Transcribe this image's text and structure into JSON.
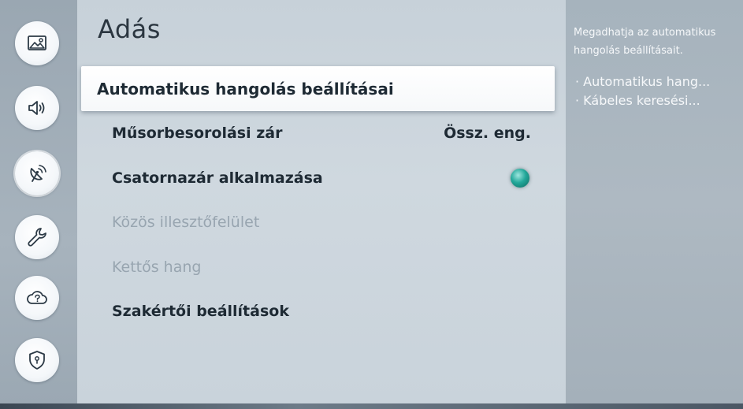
{
  "sidebar": {
    "items": [
      {
        "icon": "picture-icon",
        "active": false
      },
      {
        "icon": "sound-icon",
        "active": false
      },
      {
        "icon": "broadcast-icon",
        "active": true
      },
      {
        "icon": "wrench-icon",
        "active": false
      },
      {
        "icon": "support-cloud-icon",
        "active": false
      },
      {
        "icon": "shield-icon",
        "active": false
      }
    ]
  },
  "main": {
    "title": "Adás",
    "items": [
      {
        "label": "Automatikus hangolás beállításai",
        "value": "",
        "state": "focused"
      },
      {
        "label": "Műsorbesorolási zár",
        "value": "Össz. eng.",
        "state": "enabled"
      },
      {
        "label": "Csatornazár alkalmazása",
        "value": "",
        "state": "enabled",
        "toggle": "on"
      },
      {
        "label": "Közös illesztőfelület",
        "value": "",
        "state": "disabled"
      },
      {
        "label": "Kettős hang",
        "value": "",
        "state": "disabled"
      },
      {
        "label": "Szakértői beállítások",
        "value": "",
        "state": "enabled"
      }
    ]
  },
  "help": {
    "description_line1": "Megadhatja az automatikus",
    "description_line2": "hangolás beállításait.",
    "items": [
      "Automatikus hang...",
      "Kábeles keresési..."
    ]
  },
  "colors": {
    "toggle_on": "#23a89a",
    "text_primary": "#1e2a34",
    "text_disabled": "#98a5b0",
    "help_text": "#f6f8fa"
  }
}
